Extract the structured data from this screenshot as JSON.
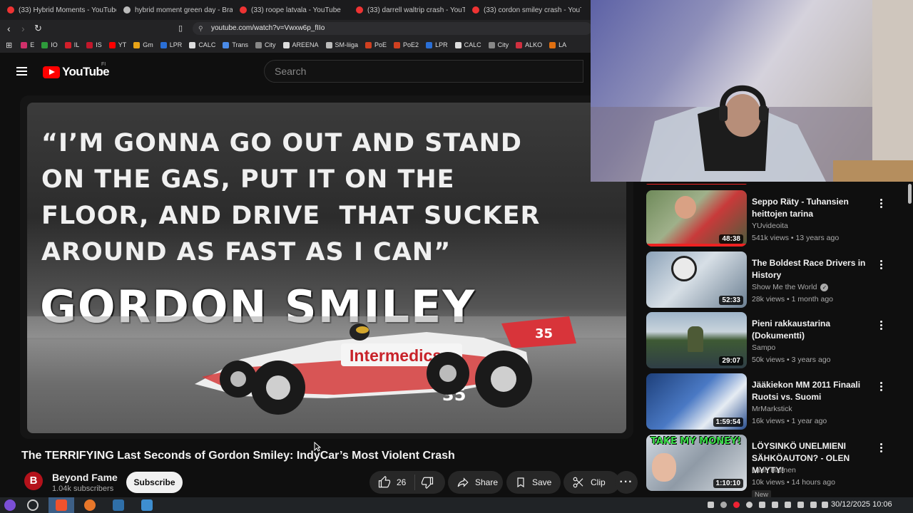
{
  "browser": {
    "tabs": [
      {
        "label": "(33) Hybrid Moments - YouTube"
      },
      {
        "label": "hybrid moment green day - Brav"
      },
      {
        "label": "(33) roope latvala - YouTube"
      },
      {
        "label": "(33) darrell waltrip crash - YouTu"
      },
      {
        "label": "(33) cordon smiley crash - YouTu"
      }
    ],
    "url": "youtube.com/watch?v=Vwxw6p_fIIo",
    "bookmarks": [
      {
        "label": "E",
        "color": "#d0306a"
      },
      {
        "label": "IO",
        "color": "#2e9b3b"
      },
      {
        "label": "IL",
        "color": "#d21f2a"
      },
      {
        "label": "IS",
        "color": "#c2172b"
      },
      {
        "label": "YT",
        "color": "#ff0000"
      },
      {
        "label": "Gm",
        "color": "#e8a317"
      },
      {
        "label": "LPR",
        "color": "#2a6fd6"
      },
      {
        "label": "CALC",
        "color": "#dddddd"
      },
      {
        "label": "Trans",
        "color": "#4a8be8"
      },
      {
        "label": "City",
        "color": "#888888"
      },
      {
        "label": "AREENA",
        "color": "#dddddd"
      },
      {
        "label": "SM-liiga",
        "color": "#bbbbbb"
      },
      {
        "label": "PoE",
        "color": "#d04020"
      },
      {
        "label": "PoE2",
        "color": "#d04020"
      },
      {
        "label": "LPR",
        "color": "#2a6fd6"
      },
      {
        "label": "CALC",
        "color": "#dddddd"
      },
      {
        "label": "City",
        "color": "#888888"
      },
      {
        "label": "ALKO",
        "color": "#d03040"
      },
      {
        "label": "LA",
        "color": "#e07010"
      }
    ]
  },
  "youtube": {
    "logo_text": "YouTube",
    "country_code": "FI",
    "search_placeholder": "Search"
  },
  "video": {
    "overlay_quote": "“I’M GONNA GO OUT AND STAND\nON THE GAS, PUT IT ON THE\nFLOOR, AND DRIVE  THAT SUCKER\nAROUND AS FAST AS I CAN”",
    "overlay_name": "GORDON SMILEY",
    "car_sponsor": "Intermedics",
    "car_number": "35",
    "title": "The TERRIFYING Last Seconds of Gordon Smiley: IndyCar’s Most Violent Crash",
    "channel": "Beyond Fame",
    "channel_avatar_letter": "B",
    "subscribers": "1.04k subscribers",
    "subscribe_label": "Subscribe",
    "likes": "26",
    "share_label": "Share",
    "save_label": "Save",
    "clip_label": "Clip"
  },
  "recommended": [
    {
      "title": "Seppo Räty - Tuhansien heittojen tarina",
      "channel": "YUvideoita",
      "views": "541k views",
      "age": "13 years ago",
      "duration": "48:38",
      "verified": false,
      "new": false
    },
    {
      "title": "The Boldest Race Drivers in History",
      "channel": "Show Me the World",
      "views": "28k views",
      "age": "1 month ago",
      "duration": "52:33",
      "verified": true,
      "new": false
    },
    {
      "title": "Pieni rakkaustarina (Dokumentti)",
      "channel": "Sampo",
      "views": "50k views",
      "age": "3 years ago",
      "duration": "29:07",
      "verified": false,
      "new": false
    },
    {
      "title": "Jääkiekon MM 2011 Finaali Ruotsi vs. Suomi",
      "channel": "MrMarkstick",
      "views": "16k views",
      "age": "1 year ago",
      "duration": "1:59:54",
      "verified": false,
      "new": false
    },
    {
      "title": "LÖYSINKÖ UNELMIENI SÄHKÖAUTON? - OLEN MYYTY!",
      "channel": "Lauri Halinen",
      "views": "10k views",
      "age": "14 hours ago",
      "duration": "1:10:10",
      "verified": false,
      "new": true,
      "new_label": "New",
      "thumb_text": "TAKE MY MONEY!"
    }
  ],
  "taskbar": {
    "clock": "30/12/2025 10:06"
  }
}
